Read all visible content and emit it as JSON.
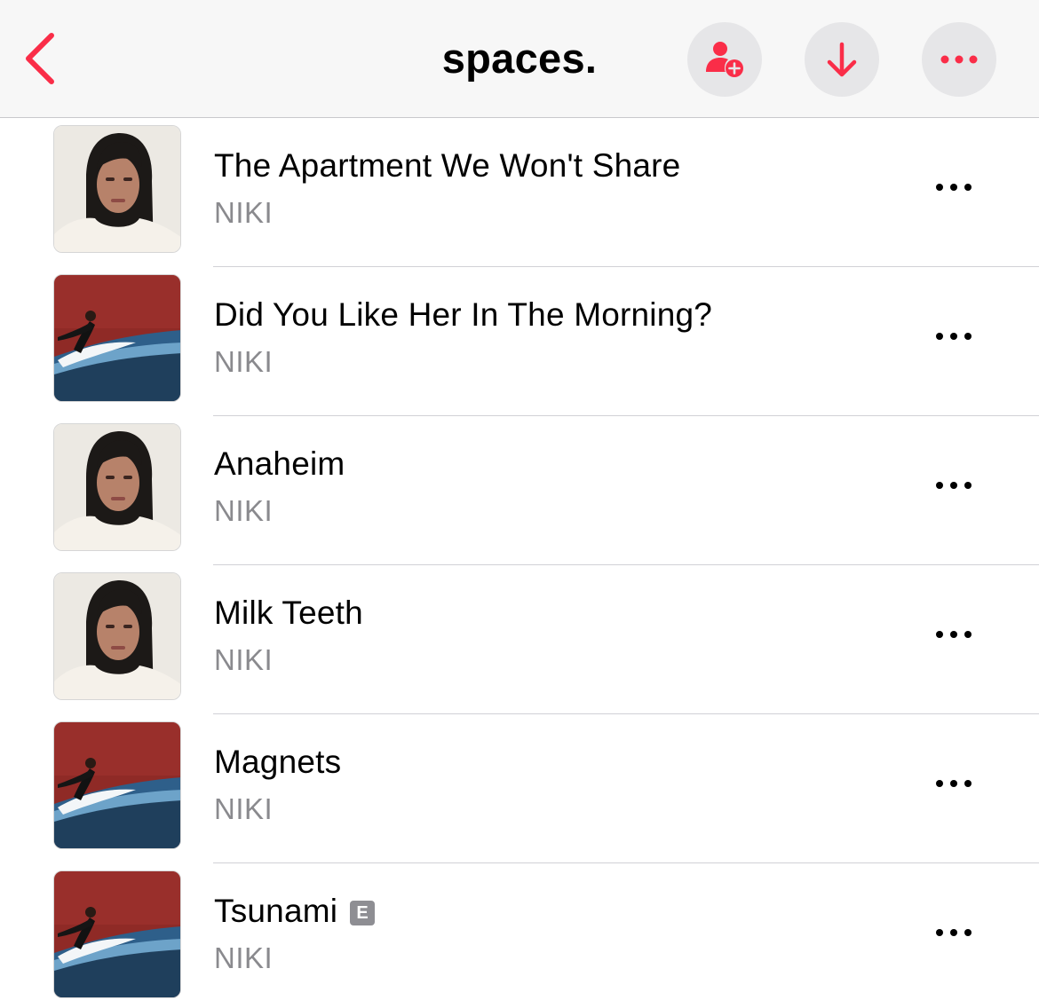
{
  "nav": {
    "title": "spaces.",
    "accent_color": "#fa2d48",
    "back_icon": "chevron-left-icon",
    "actions": [
      {
        "name": "add-collaborator-button",
        "icon": "person-add-icon"
      },
      {
        "name": "download-button",
        "icon": "arrow-down-icon"
      },
      {
        "name": "more-button",
        "icon": "ellipsis-icon"
      }
    ]
  },
  "tracks": [
    {
      "title": "The Apartment We Won't Share",
      "artist": "NIKI",
      "artwork": "portrait-artwork",
      "explicit": false
    },
    {
      "title": "Did You Like Her In The Morning?",
      "artist": "NIKI",
      "artwork": "red-wall-car-artwork",
      "explicit": false
    },
    {
      "title": "Anaheim",
      "artist": "NIKI",
      "artwork": "portrait-artwork",
      "explicit": false
    },
    {
      "title": "Milk Teeth",
      "artist": "NIKI",
      "artwork": "portrait-artwork",
      "explicit": false
    },
    {
      "title": "Magnets",
      "artist": "NIKI",
      "artwork": "red-wall-car-artwork",
      "explicit": false
    },
    {
      "title": "Tsunami",
      "artist": "NIKI",
      "artwork": "red-wall-car-artwork",
      "explicit": true,
      "explicit_label": "E"
    }
  ]
}
